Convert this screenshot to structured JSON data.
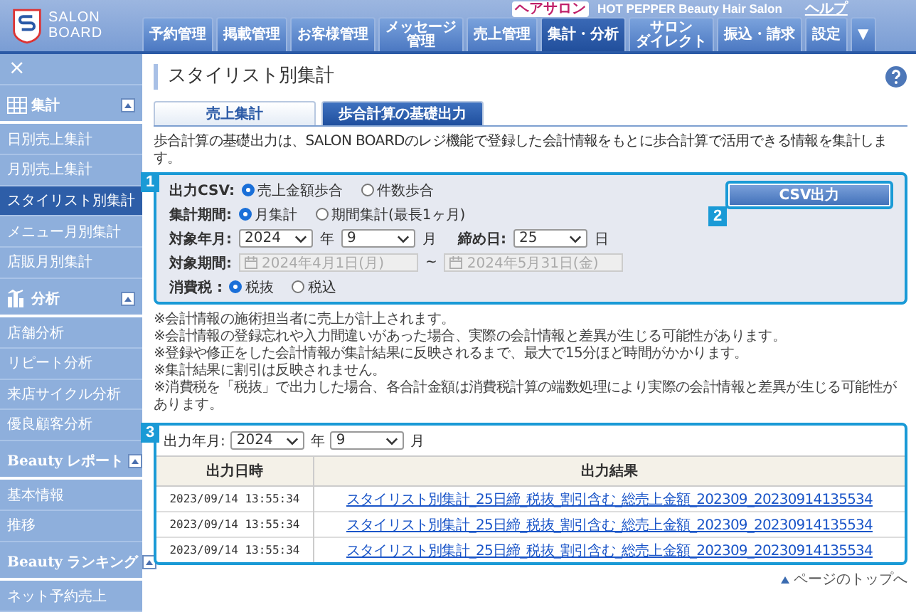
{
  "header": {
    "logo": [
      "SALON",
      "BOARD"
    ],
    "badge": "ヘアサロン",
    "salon_name": "HOT PEPPER Beauty Hair Salon",
    "help": "ヘルプ",
    "nav": [
      {
        "lines": [
          "予約管理"
        ],
        "selected": false
      },
      {
        "lines": [
          "掲載管理"
        ],
        "selected": false
      },
      {
        "lines": [
          "お客様管理"
        ],
        "selected": false
      },
      {
        "lines": [
          "メッセージ",
          "管理"
        ],
        "selected": false
      },
      {
        "lines": [
          "売上管理"
        ],
        "selected": false
      },
      {
        "lines": [
          "集計・分析"
        ],
        "selected": true
      },
      {
        "lines": [
          "サロン",
          "ダイレクト"
        ],
        "selected": false
      },
      {
        "lines": [
          "振込・請求"
        ],
        "selected": false
      },
      {
        "lines": [
          "設定"
        ],
        "selected": false
      },
      {
        "lines": [
          "▼"
        ],
        "selected": false
      }
    ]
  },
  "sidebar": {
    "close": "×",
    "sections": [
      {
        "kind": "grid",
        "title": "集計",
        "expanded": true,
        "items": [
          {
            "label": "日別売上集計",
            "selected": false
          },
          {
            "label": "月別売上集計",
            "selected": false
          },
          {
            "label": "スタイリスト別集計",
            "selected": true
          },
          {
            "label": "メニュー月別集計",
            "selected": false
          },
          {
            "label": "店販月別集計",
            "selected": false
          }
        ]
      },
      {
        "kind": "chart",
        "title": "分析",
        "expanded": true,
        "items": [
          {
            "label": "店舗分析",
            "selected": false
          },
          {
            "label": "リピート分析",
            "selected": false
          },
          {
            "label": "来店サイクル分析",
            "selected": false
          },
          {
            "label": "優良顧客分析",
            "selected": false
          }
        ]
      },
      {
        "kind": "beauty",
        "logo_text": "Beauty",
        "title": "レポート",
        "expanded": true,
        "items": [
          {
            "label": "基本情報",
            "selected": false
          },
          {
            "label": "推移",
            "selected": false
          }
        ]
      },
      {
        "kind": "beauty",
        "logo_text": "Beauty",
        "title": "ランキング",
        "expanded": true,
        "items": [
          {
            "label": "ネット予約売上",
            "selected": false
          }
        ]
      }
    ]
  },
  "main": {
    "title": "スタイリスト別集計",
    "tabs": [
      {
        "label": "売上集計",
        "selected": false
      },
      {
        "label": "歩合計算の基礎出力",
        "selected": true
      }
    ],
    "intro": "歩合計算の基礎出力は、SALON BOARDのレジ機能で登録した会計情報をもとに歩合計算で活用できる情報を集計します。",
    "markers": [
      "1",
      "2",
      "3"
    ],
    "form": [
      {
        "kind": "radio",
        "label": "出力CSV:",
        "options": [
          {
            "label": "売上金額歩合",
            "selected": true
          },
          {
            "label": "件数歩合",
            "selected": false
          }
        ]
      },
      {
        "kind": "radio",
        "label": "集計期間:",
        "options": [
          {
            "label": "月集計",
            "selected": true
          },
          {
            "label": "期間集計(最長1ヶ月)",
            "selected": false
          }
        ]
      },
      {
        "kind": "selects",
        "label": "対象年月:",
        "parts": [
          {
            "kind": "select",
            "value": "2024"
          },
          {
            "kind": "text",
            "text": "年"
          },
          {
            "kind": "select",
            "value": "9"
          },
          {
            "kind": "text",
            "text": "月"
          },
          {
            "kind": "label",
            "text": "締め日:"
          },
          {
            "kind": "select",
            "value": "25"
          },
          {
            "kind": "text",
            "text": "日"
          }
        ]
      },
      {
        "kind": "dates",
        "label": "対象期間:",
        "disabled": true,
        "from": "2024年4月1日(月)",
        "separator": "~",
        "to": "2024年5月31日(金)"
      },
      {
        "kind": "radio",
        "label": "消費税 :",
        "options": [
          {
            "label": "税抜",
            "selected": true
          },
          {
            "label": "税込",
            "selected": false
          }
        ]
      }
    ],
    "csv_button": "CSV出力",
    "notes": [
      "※会計情報の施術担当者に売上が計上されます。",
      "※会計情報の登録忘れや入力間違いがあった場合、実際の会計情報と差異が生じる可能性があります。",
      "※登録や修正をした会計情報が集計結果に反映されるまで、最大で15分ほど時間がかかります。",
      "※集計結果に割引は反映されません。",
      "※消費税を「税抜」で出力した場合、各合計金額は消費税計算の端数処理により実際の会計情報と差異が生じる可能性があります。"
    ],
    "output": {
      "label": "出力年月:",
      "year": "2024",
      "year_unit": "年",
      "month": "9",
      "month_unit": "月",
      "columns": [
        "出力日時",
        "出力結果"
      ],
      "rows": [
        {
          "date": "2023/09/14 13:55:34",
          "file": "スタイリスト別集計_25日締_税抜_割引含む_総売上金額_202309_20230914135534"
        },
        {
          "date": "2023/09/14 13:55:34",
          "file": "スタイリスト別集計_25日締_税抜_割引含む_総売上金額_202309_20230914135534"
        },
        {
          "date": "2023/09/14 13:55:34",
          "file": "スタイリスト別集計_25日締_税抜_割引含む_総売上金額_202309_20230914135534"
        }
      ]
    },
    "page_top": "ページのトップへ"
  }
}
